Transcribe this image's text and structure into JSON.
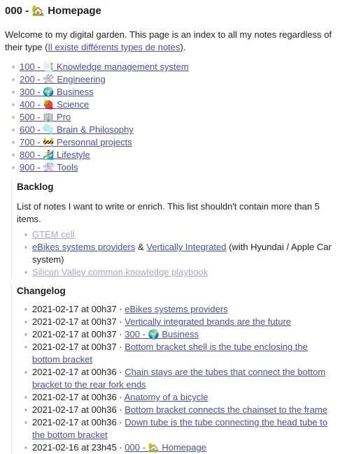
{
  "title": "000 - 🏡 Homepage",
  "intro": {
    "text": "Welcome to my digital garden. This page is an index to all my notes regardless of their type (",
    "link": "Il existe différents types de notes",
    "suffix": ")."
  },
  "index_links": [
    "100 - 📑 Knowledge management system",
    "200 - 🛠 Engineering",
    "300 - 🌍 Business",
    "400 - 🍓 Science",
    "500 - 🏢 Pro",
    "600 - 🫧 Brain & Philosophy",
    "700 - 🚧 Personnal projects",
    "800 - 🏄 Lifestyle",
    "900 - 🛠 Tools"
  ],
  "backlog": {
    "heading": "Backlog",
    "description": "List of notes I want to write or enrich. This list shouldn't contain more than 5 items.",
    "items": [
      {
        "link": "GTEM cell"
      },
      {
        "link": "eBikes systems providers",
        "sep": " & ",
        "link2": "Vertically Integrated",
        "suffix": " (with Hyundai / Apple Car system)"
      },
      {
        "link": "Silicon Valley common knowledge playbook"
      }
    ]
  },
  "changelog": {
    "heading": "Changelog",
    "entries": [
      {
        "time": "2021-02-17 at 00h37 · ",
        "link": "eBikes systems providers"
      },
      {
        "time": "2021-02-17 at 00h37 · ",
        "link": "Vertically integrated brands are the future"
      },
      {
        "time": "2021-02-17 at 00h37 · ",
        "link": "300 - 🌍 Business"
      },
      {
        "time": "2021-02-17 at 00h37 · ",
        "link": "Bottom bracket shell is the tube enclosing the bottom bracket"
      },
      {
        "time": "2021-02-17 at 00h36 · ",
        "link": "Chain stays are the tubes that connect the bottom bracket to the rear fork ends"
      },
      {
        "time": "2021-02-17 at 00h36 · ",
        "link": "Anatomy of a bicycle"
      },
      {
        "time": "2021-02-17 at 00h36 · ",
        "link": "Bottom bracket connects the chainset to the frame"
      },
      {
        "time": "2021-02-17 at 00h36 · ",
        "link": "Down tube is the tube connecting the head tube to the bottom bracket"
      },
      {
        "time": "2021-02-16 at 23h45 · ",
        "link": "000 - 🏡 Homepage"
      }
    ]
  },
  "colors": {
    "link": "#4a4da6",
    "link_faded": "#a5a8cf",
    "text": "#1f1f1f",
    "bullet": "#bdbdbd"
  }
}
